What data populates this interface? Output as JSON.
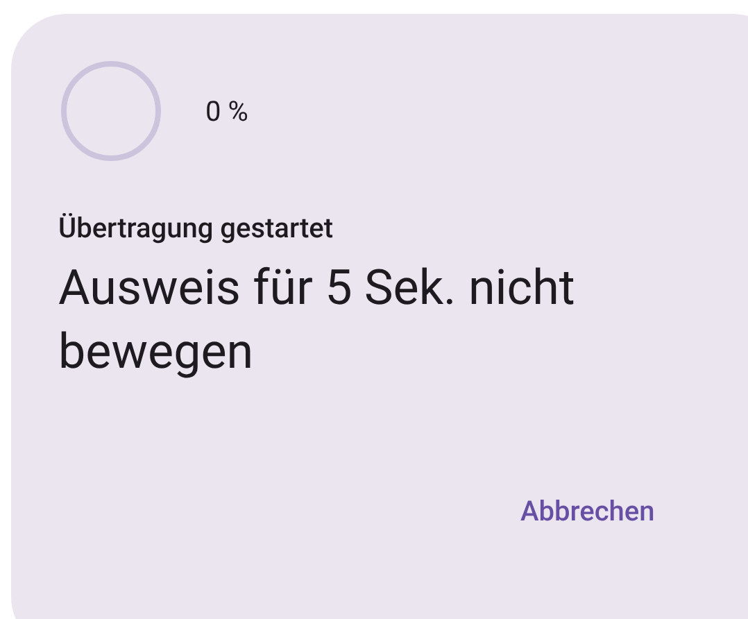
{
  "progress": {
    "level": 0,
    "reading": "0 %"
  },
  "title": "Übertragung gestartet",
  "message": "Ausweis für 5 Sek. nicht bewegen",
  "buttons": [
    "Abbrechen"
  ]
}
